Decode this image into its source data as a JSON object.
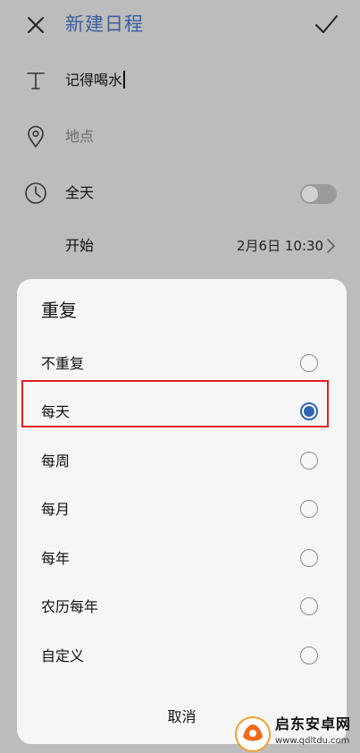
{
  "header": {
    "title": "新建日程",
    "close_icon": "close-icon",
    "confirm_icon": "check-icon"
  },
  "form": {
    "title_row": {
      "icon": "text-icon",
      "value": "记得喝水"
    },
    "location_row": {
      "icon": "location-pin-icon",
      "placeholder": "地点"
    },
    "allday_row": {
      "icon": "clock-icon",
      "label": "全天",
      "toggle_on": false
    },
    "start_row": {
      "label": "开始",
      "value": "2月6日 10:30"
    }
  },
  "repeat_sheet": {
    "title": "重复",
    "options": [
      {
        "label": "不重复",
        "selected": false
      },
      {
        "label": "每天",
        "selected": true
      },
      {
        "label": "每周",
        "selected": false
      },
      {
        "label": "每月",
        "selected": false
      },
      {
        "label": "每年",
        "selected": false
      },
      {
        "label": "农历每年",
        "selected": false
      },
      {
        "label": "自定义",
        "selected": false
      }
    ],
    "cancel_label": "取消"
  },
  "watermark": {
    "name": "启东安卓网",
    "url": "www.qdltdu.com"
  },
  "colors": {
    "accent": "#2f63b3",
    "title_blue": "#3b5fa0",
    "highlight_red": "#e02020",
    "overlay_bg": "#bcbcbc",
    "sheet_bg": "#f6f6f6"
  }
}
